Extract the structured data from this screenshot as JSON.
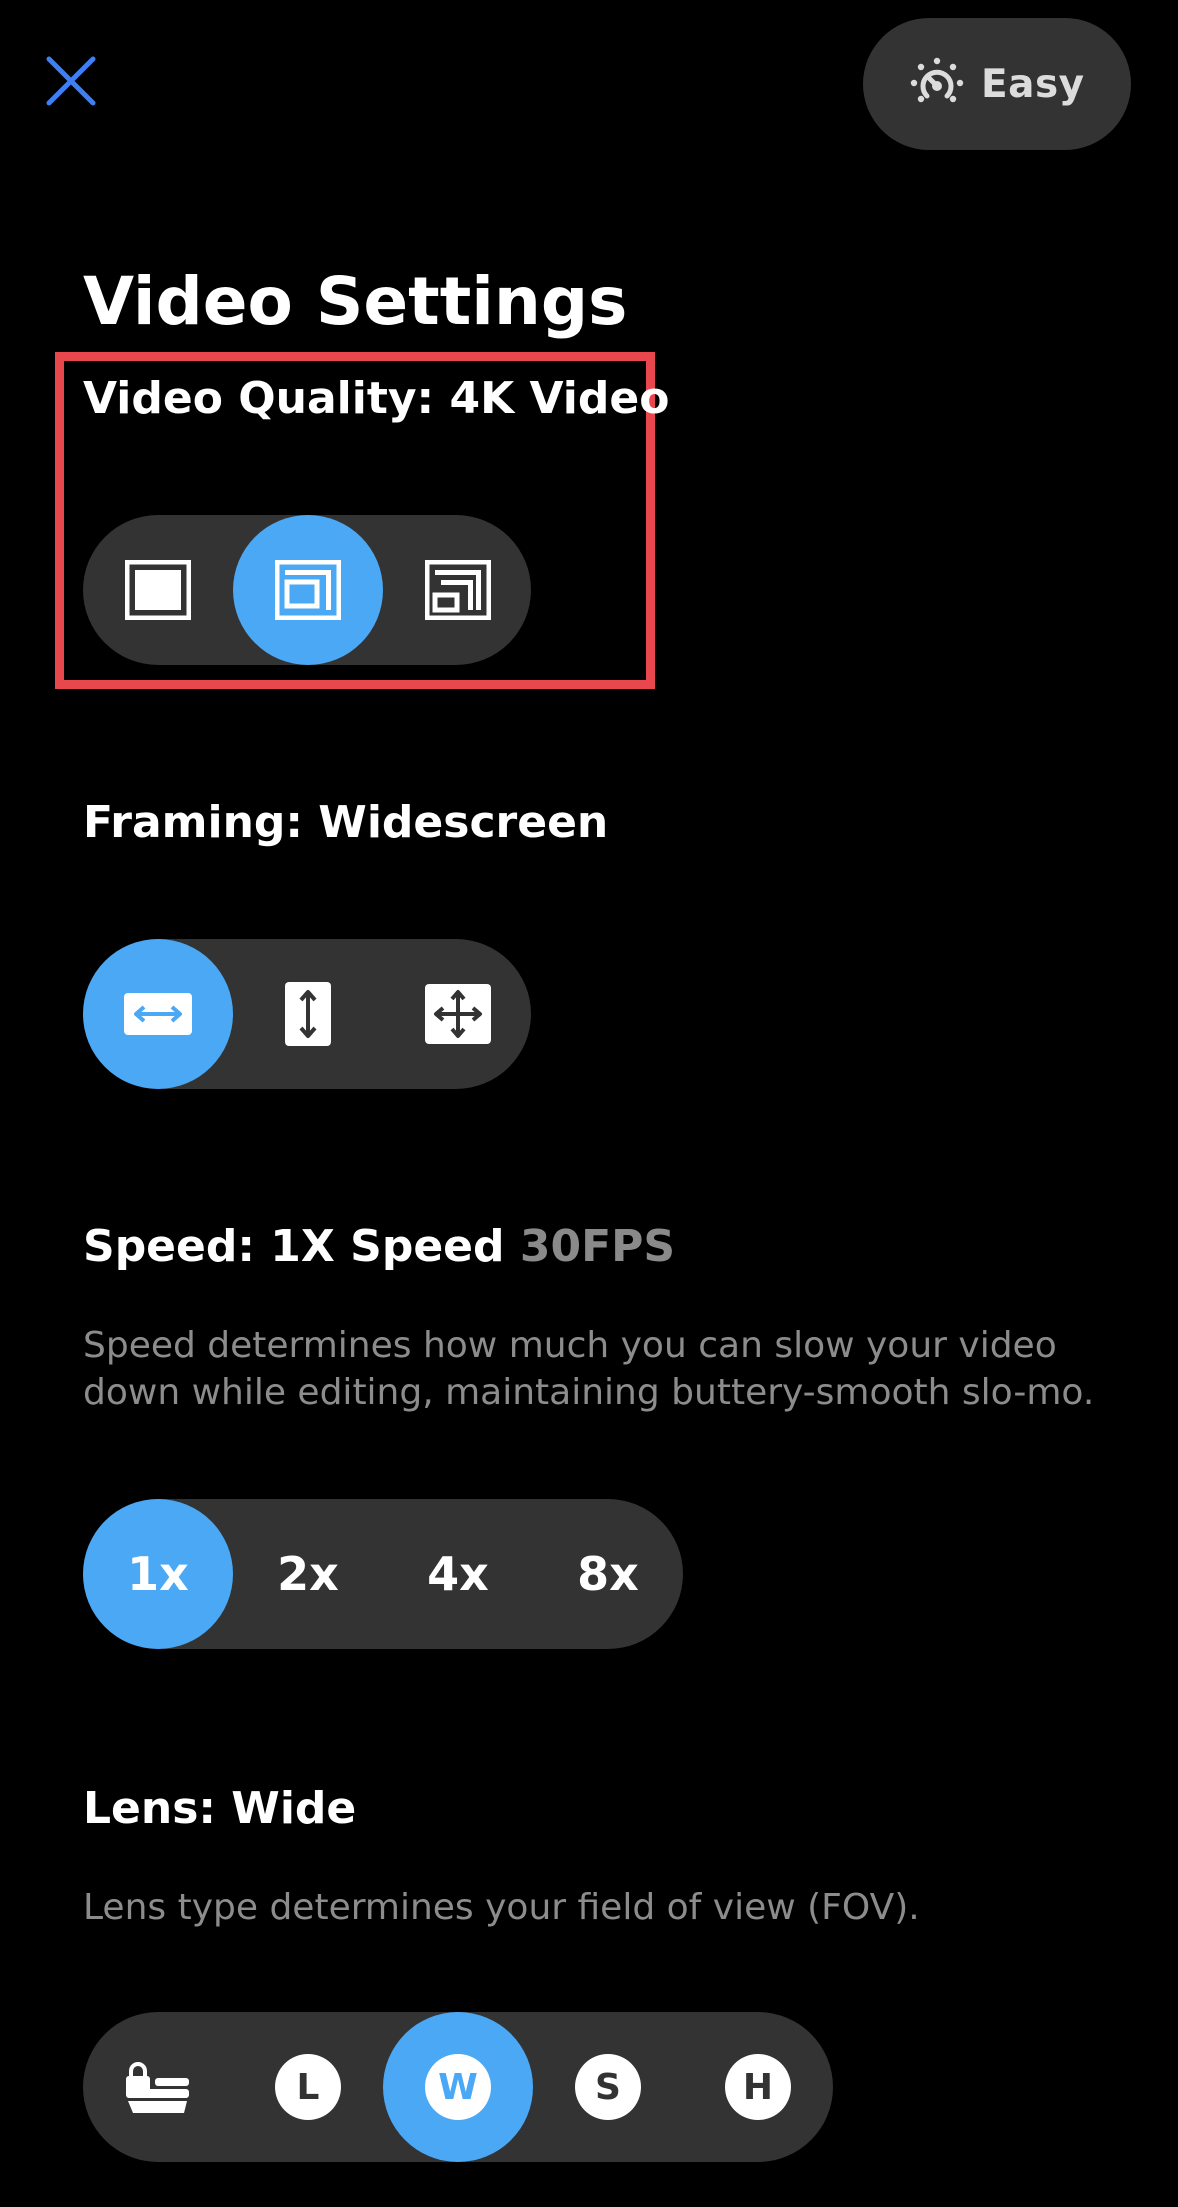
{
  "header": {
    "close_icon": "close-x-icon",
    "mode": {
      "icon": "dial-icon",
      "label": "Easy"
    }
  },
  "page_title": "Video Settings",
  "video_quality": {
    "label": "Video Quality: 4K Video",
    "options": [
      {
        "icon": "quality-full-frame-icon",
        "selected": false
      },
      {
        "icon": "quality-4k-frame-icon",
        "selected": true
      },
      {
        "icon": "quality-small-frame-icon",
        "selected": false
      }
    ]
  },
  "framing": {
    "label": "Framing: Widescreen",
    "options": [
      {
        "icon": "widescreen-arrows-icon",
        "selected": true
      },
      {
        "icon": "vertical-arrows-icon",
        "selected": false
      },
      {
        "icon": "full-frame-arrows-icon",
        "selected": false
      }
    ]
  },
  "speed": {
    "label": "Speed: 1X Speed",
    "fps": "30FPS",
    "description": "Speed determines how much you can slow your video down while editing, maintaining buttery-smooth slo-mo.",
    "options": [
      {
        "label": "1x",
        "selected": true
      },
      {
        "label": "2x",
        "selected": false
      },
      {
        "label": "4x",
        "selected": false
      },
      {
        "label": "8x",
        "selected": false
      }
    ]
  },
  "lens": {
    "label": "Lens: Wide",
    "description": "Lens type determines your field of view (FOV).",
    "options": [
      {
        "icon": "lens-lock-icon",
        "label": "",
        "selected": false
      },
      {
        "icon": "lens-linear-icon",
        "label": "L",
        "selected": false
      },
      {
        "icon": "lens-wide-icon",
        "label": "W",
        "selected": true
      },
      {
        "icon": "lens-superview-icon",
        "label": "S",
        "selected": false
      },
      {
        "icon": "lens-hyperview-icon",
        "label": "H",
        "selected": false
      }
    ]
  },
  "colors": {
    "accent": "#4ba8f5",
    "pill_bg": "#333333",
    "highlight_border": "#e8474d",
    "muted_text": "#8c8c8c"
  }
}
